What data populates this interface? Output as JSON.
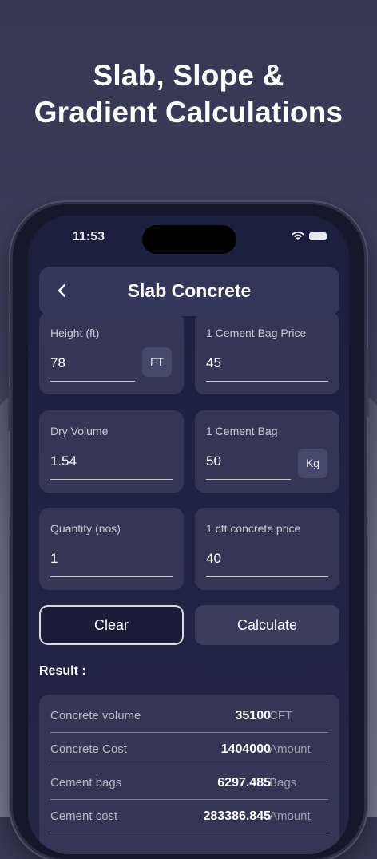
{
  "headline": {
    "line1": "Slab, Slope &",
    "line2": "Gradient Calculations"
  },
  "status_bar": {
    "time": "11:53"
  },
  "app_bar": {
    "title": "Slab Concrete",
    "back_icon": "chevron-left-icon"
  },
  "fields": [
    {
      "label": "Height (ft)",
      "value": "78",
      "unit": "FT"
    },
    {
      "label": "1 Cement Bag Price",
      "value": "45",
      "unit": ""
    },
    {
      "label": "Dry Volume",
      "value": "1.54",
      "unit": ""
    },
    {
      "label": "1 Cement Bag",
      "value": "50",
      "unit": "Kg"
    },
    {
      "label": "Quantity (nos)",
      "value": "1",
      "unit": ""
    },
    {
      "label": "1 cft concrete price",
      "value": "40",
      "unit": ""
    }
  ],
  "buttons": {
    "clear": "Clear",
    "calculate": "Calculate"
  },
  "result": {
    "heading": "Result :",
    "rows": [
      {
        "label": "Concrete volume",
        "value": "35100",
        "unit": "CFT"
      },
      {
        "label": "Concrete Cost",
        "value": "1404000",
        "unit": "Amount"
      },
      {
        "label": "Cement bags",
        "value": "6297.485",
        "unit": "Bags"
      },
      {
        "label": "Cement cost",
        "value": "283386.845",
        "unit": "Amount"
      }
    ]
  }
}
